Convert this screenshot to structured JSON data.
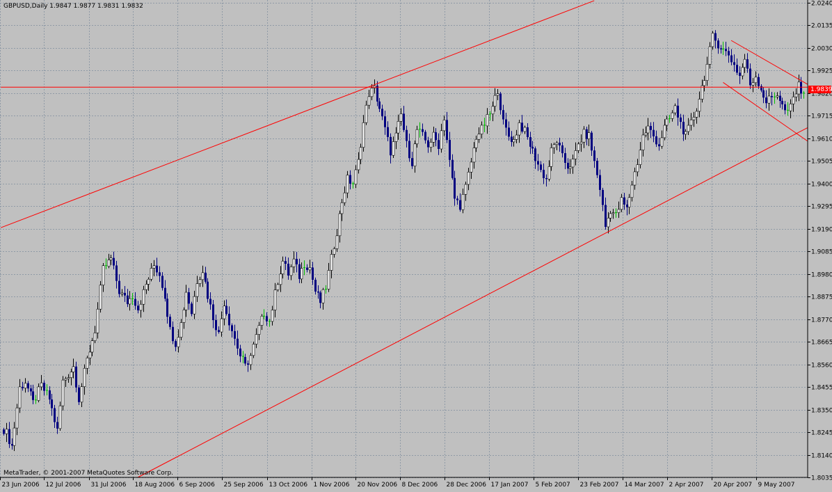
{
  "header": {
    "symbol_line": "GBPUSD,Daily  1.9847 1.9877 1.9831 1.9832"
  },
  "footer": {
    "copyright": "MetaTrader, © 2001-2007 MetaQuotes Software Corp."
  },
  "chart_data": {
    "type": "candlestick",
    "symbol": "GBPUSD",
    "timeframe": "Daily",
    "last_quote": {
      "open": 1.9847,
      "high": 1.9877,
      "low": 1.9831,
      "close": 1.9832
    },
    "current_price_label": "1.9839",
    "ylim": [
      1.8035,
      2.024
    ],
    "y_ticks": [
      "2.0240",
      "2.0135",
      "2.0030",
      "1.9925",
      "1.9820",
      "1.9715",
      "1.9610",
      "1.9505",
      "1.9400",
      "1.9295",
      "1.9190",
      "1.9085",
      "1.8980",
      "1.8875",
      "1.8770",
      "1.8665",
      "1.8560",
      "1.8455",
      "1.8350",
      "1.8245",
      "1.8140",
      "1.8035"
    ],
    "x_ticks": [
      "23 Jun 2006",
      "12 Jul 2006",
      "31 Jul 2006",
      "18 Aug 2006",
      "6 Sep 2006",
      "25 Sep 2006",
      "13 Oct 2006",
      "1 Nov 2006",
      "20 Nov 2006",
      "8 Dec 2006",
      "28 Dec 2006",
      "17 Jan 2007",
      "5 Feb 2007",
      "23 Feb 2007",
      "14 Mar 2007",
      "2 Apr 2007",
      "20 Apr 2007",
      "9 May 2007"
    ],
    "grid": true,
    "colors": {
      "background": "#c0c0c0",
      "grid": "#8f9aa6",
      "bull_candle": "#ffffff",
      "bear_candle": "#000080",
      "doji": "#00c000",
      "trendline": "#ff0000",
      "price_tag": "#ff0000"
    },
    "anchors": [
      {
        "i": 0,
        "p": 1.826
      },
      {
        "i": 1,
        "p": 1.824
      },
      {
        "i": 3,
        "p": 1.818
      },
      {
        "i": 6,
        "p": 1.845
      },
      {
        "i": 8,
        "p": 1.848
      },
      {
        "i": 11,
        "p": 1.838
      },
      {
        "i": 14,
        "p": 1.846
      },
      {
        "i": 17,
        "p": 1.84
      },
      {
        "i": 20,
        "p": 1.825
      },
      {
        "i": 22,
        "p": 1.848
      },
      {
        "i": 26,
        "p": 1.855
      },
      {
        "i": 28,
        "p": 1.84
      },
      {
        "i": 31,
        "p": 1.858
      },
      {
        "i": 34,
        "p": 1.872
      },
      {
        "i": 37,
        "p": 1.9
      },
      {
        "i": 40,
        "p": 1.905
      },
      {
        "i": 43,
        "p": 1.89
      },
      {
        "i": 46,
        "p": 1.885
      },
      {
        "i": 48,
        "p": 1.888
      },
      {
        "i": 50,
        "p": 1.882
      },
      {
        "i": 53,
        "p": 1.893
      },
      {
        "i": 56,
        "p": 1.902
      },
      {
        "i": 58,
        "p": 1.898
      },
      {
        "i": 60,
        "p": 1.888
      },
      {
        "i": 62,
        "p": 1.872
      },
      {
        "i": 64,
        "p": 1.866
      },
      {
        "i": 66,
        "p": 1.875
      },
      {
        "i": 68,
        "p": 1.89
      },
      {
        "i": 70,
        "p": 1.88
      },
      {
        "i": 72,
        "p": 1.895
      },
      {
        "i": 74,
        "p": 1.9
      },
      {
        "i": 76,
        "p": 1.888
      },
      {
        "i": 78,
        "p": 1.878
      },
      {
        "i": 80,
        "p": 1.87
      },
      {
        "i": 82,
        "p": 1.885
      },
      {
        "i": 84,
        "p": 1.876
      },
      {
        "i": 86,
        "p": 1.868
      },
      {
        "i": 88,
        "p": 1.86
      },
      {
        "i": 90,
        "p": 1.855
      },
      {
        "i": 92,
        "p": 1.86
      },
      {
        "i": 95,
        "p": 1.873
      },
      {
        "i": 97,
        "p": 1.88
      },
      {
        "i": 99,
        "p": 1.876
      },
      {
        "i": 102,
        "p": 1.895
      },
      {
        "i": 104,
        "p": 1.904
      },
      {
        "i": 106,
        "p": 1.898
      },
      {
        "i": 108,
        "p": 1.904
      },
      {
        "i": 110,
        "p": 1.897
      },
      {
        "i": 112,
        "p": 1.903
      },
      {
        "i": 114,
        "p": 1.901
      },
      {
        "i": 116,
        "p": 1.89
      },
      {
        "i": 118,
        "p": 1.885
      },
      {
        "i": 120,
        "p": 1.892
      },
      {
        "i": 122,
        "p": 1.905
      },
      {
        "i": 124,
        "p": 1.918
      },
      {
        "i": 126,
        "p": 1.932
      },
      {
        "i": 128,
        "p": 1.942
      },
      {
        "i": 130,
        "p": 1.94
      },
      {
        "i": 132,
        "p": 1.95
      },
      {
        "i": 134,
        "p": 1.968
      },
      {
        "i": 136,
        "p": 1.982
      },
      {
        "i": 138,
        "p": 1.984
      },
      {
        "i": 140,
        "p": 1.975
      },
      {
        "i": 142,
        "p": 1.965
      },
      {
        "i": 144,
        "p": 1.955
      },
      {
        "i": 146,
        "p": 1.962
      },
      {
        "i": 148,
        "p": 1.972
      },
      {
        "i": 150,
        "p": 1.958
      },
      {
        "i": 152,
        "p": 1.95
      },
      {
        "i": 154,
        "p": 1.965
      },
      {
        "i": 156,
        "p": 1.962
      },
      {
        "i": 158,
        "p": 1.958
      },
      {
        "i": 160,
        "p": 1.962
      },
      {
        "i": 162,
        "p": 1.958
      },
      {
        "i": 164,
        "p": 1.971
      },
      {
        "i": 166,
        "p": 1.95
      },
      {
        "i": 168,
        "p": 1.933
      },
      {
        "i": 170,
        "p": 1.93
      },
      {
        "i": 172,
        "p": 1.938
      },
      {
        "i": 174,
        "p": 1.95
      },
      {
        "i": 176,
        "p": 1.962
      },
      {
        "i": 178,
        "p": 1.965
      },
      {
        "i": 180,
        "p": 1.97
      },
      {
        "i": 182,
        "p": 1.975
      },
      {
        "i": 184,
        "p": 1.984
      },
      {
        "i": 186,
        "p": 1.968
      },
      {
        "i": 188,
        "p": 1.962
      },
      {
        "i": 190,
        "p": 1.96
      },
      {
        "i": 192,
        "p": 1.968
      },
      {
        "i": 194,
        "p": 1.964
      },
      {
        "i": 196,
        "p": 1.958
      },
      {
        "i": 198,
        "p": 1.952
      },
      {
        "i": 200,
        "p": 1.946
      },
      {
        "i": 202,
        "p": 1.942
      },
      {
        "i": 204,
        "p": 1.955
      },
      {
        "i": 206,
        "p": 1.96
      },
      {
        "i": 208,
        "p": 1.952
      },
      {
        "i": 210,
        "p": 1.948
      },
      {
        "i": 212,
        "p": 1.95
      },
      {
        "i": 214,
        "p": 1.958
      },
      {
        "i": 216,
        "p": 1.963
      },
      {
        "i": 218,
        "p": 1.962
      },
      {
        "i": 220,
        "p": 1.95
      },
      {
        "i": 222,
        "p": 1.938
      },
      {
        "i": 224,
        "p": 1.92
      },
      {
        "i": 226,
        "p": 1.928
      },
      {
        "i": 228,
        "p": 1.925
      },
      {
        "i": 230,
        "p": 1.932
      },
      {
        "i": 232,
        "p": 1.928
      },
      {
        "i": 234,
        "p": 1.94
      },
      {
        "i": 236,
        "p": 1.95
      },
      {
        "i": 238,
        "p": 1.962
      },
      {
        "i": 240,
        "p": 1.966
      },
      {
        "i": 242,
        "p": 1.962
      },
      {
        "i": 244,
        "p": 1.958
      },
      {
        "i": 246,
        "p": 1.966
      },
      {
        "i": 248,
        "p": 1.97
      },
      {
        "i": 250,
        "p": 1.975
      },
      {
        "i": 252,
        "p": 1.968
      },
      {
        "i": 254,
        "p": 1.962
      },
      {
        "i": 256,
        "p": 1.968
      },
      {
        "i": 258,
        "p": 1.975
      },
      {
        "i": 260,
        "p": 1.985
      },
      {
        "i": 262,
        "p": 1.995
      },
      {
        "i": 264,
        "p": 2.008
      },
      {
        "i": 266,
        "p": 2.005
      },
      {
        "i": 268,
        "p": 2.002
      },
      {
        "i": 270,
        "p": 2.0
      },
      {
        "i": 272,
        "p": 1.995
      },
      {
        "i": 274,
        "p": 1.99
      },
      {
        "i": 276,
        "p": 1.998
      },
      {
        "i": 278,
        "p": 1.986
      },
      {
        "i": 280,
        "p": 1.99
      },
      {
        "i": 282,
        "p": 1.984
      },
      {
        "i": 284,
        "p": 1.978
      },
      {
        "i": 286,
        "p": 1.98
      },
      {
        "i": 288,
        "p": 1.982
      },
      {
        "i": 290,
        "p": 1.976
      },
      {
        "i": 292,
        "p": 1.972
      },
      {
        "i": 294,
        "p": 1.98
      },
      {
        "i": 296,
        "p": 1.985
      },
      {
        "i": 298,
        "p": 1.983
      }
    ],
    "trendlines": [
      {
        "name": "upper-channel-line",
        "from": [
          -1,
          1.9195
        ],
        "to": [
          220,
          2.025
        ]
      },
      {
        "name": "lower-channel-line",
        "from": [
          50,
          1.8035
        ],
        "to": [
          303,
          1.966
        ]
      },
      {
        "name": "resistance-line",
        "from": [
          -1,
          1.9848
        ],
        "to": [
          303,
          1.9848
        ]
      },
      {
        "name": "falling-channel-top",
        "from": [
          271,
          2.0065
        ],
        "to": [
          303,
          1.9861
        ]
      },
      {
        "name": "falling-channel-bottom",
        "from": [
          268,
          1.987
        ],
        "to": [
          303,
          1.9597
        ]
      }
    ]
  }
}
